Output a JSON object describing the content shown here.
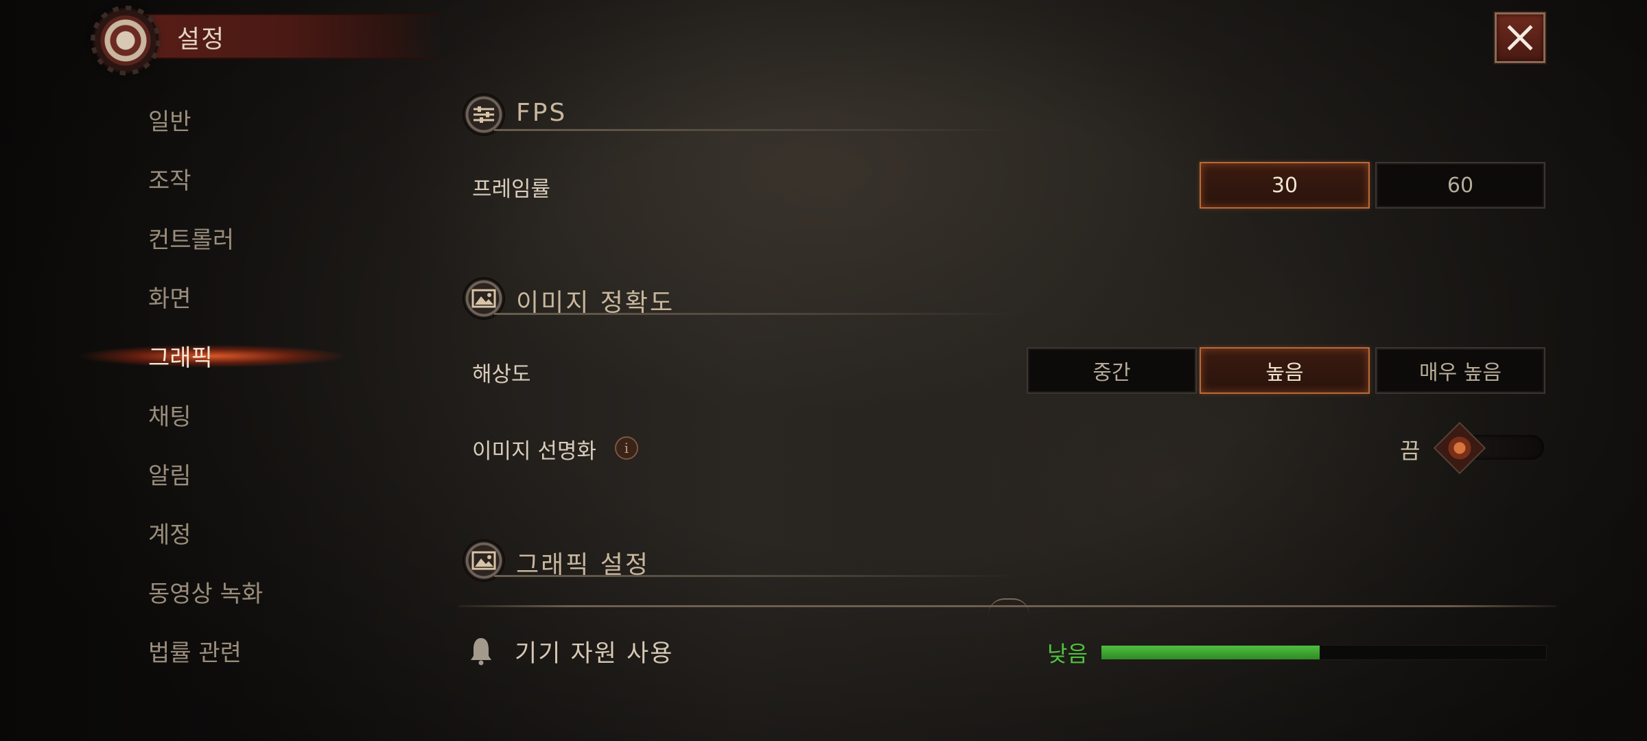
{
  "header": {
    "title": "설정",
    "close_icon": "close-icon"
  },
  "sidebar": {
    "items": [
      {
        "label": "일반"
      },
      {
        "label": "조작"
      },
      {
        "label": "컨트롤러"
      },
      {
        "label": "화면"
      },
      {
        "label": "그래픽",
        "active": true
      },
      {
        "label": "채팅"
      },
      {
        "label": "알림"
      },
      {
        "label": "계정"
      },
      {
        "label": "동영상 녹화"
      },
      {
        "label": "법률 관련"
      }
    ]
  },
  "sections": {
    "fps": {
      "title": "FPS",
      "icon": "sliders-icon",
      "frame_rate": {
        "label": "프레임률",
        "options": [
          "30",
          "60"
        ],
        "selected": "30"
      }
    },
    "image_quality": {
      "title": "이미지 정확도",
      "icon": "picture-icon",
      "resolution": {
        "label": "해상도",
        "options": [
          "중간",
          "높음",
          "매우 높음"
        ],
        "selected": "높음"
      },
      "sharpening": {
        "label": "이미지 선명화",
        "state_label": "끔",
        "on": false
      }
    },
    "graphics": {
      "title": "그래픽 설정",
      "icon": "picture-icon",
      "device_resource": {
        "label": "기기 자원 사용",
        "level": "낮음",
        "usage_fraction": 0.49
      }
    }
  },
  "colors": {
    "accent": "#b86a3a",
    "usage_green": "#4fc23e",
    "header_red": "#5c1f18"
  }
}
